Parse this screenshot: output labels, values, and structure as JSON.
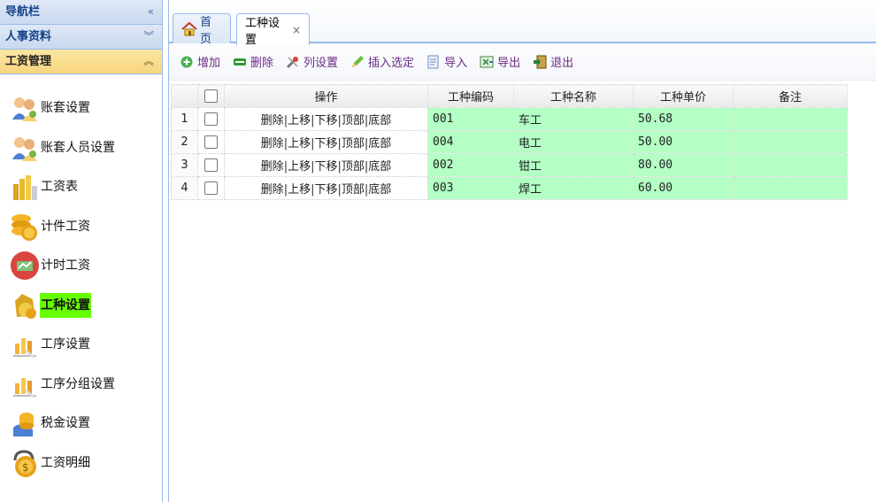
{
  "sidebar": {
    "nav_header": "导航栏",
    "hr_header": "人事资料",
    "salary_header": "工资管理",
    "items": [
      {
        "label": "账套设置",
        "icon": "people-icon"
      },
      {
        "label": "账套人员设置",
        "icon": "people-icon"
      },
      {
        "label": "工资表",
        "icon": "money-stack-icon"
      },
      {
        "label": "计件工资",
        "icon": "coins-icon"
      },
      {
        "label": "计时工资",
        "icon": "clock-money-icon"
      },
      {
        "label": "工种设置",
        "icon": "money-bag-icon",
        "selected": true
      },
      {
        "label": "工序设置",
        "icon": "chart-icon"
      },
      {
        "label": "工序分组设置",
        "icon": "chart-icon"
      },
      {
        "label": "税金设置",
        "icon": "tax-icon"
      },
      {
        "label": "工资明细",
        "icon": "moneybag-lock-icon"
      }
    ]
  },
  "tabs": {
    "home": "首页",
    "worktype": "工种设置",
    "close": "×"
  },
  "toolbar": {
    "add": "增加",
    "delete": "删除",
    "columns": "列设置",
    "insert": "插入选定",
    "import": "导入",
    "export": "导出",
    "exit": "退出"
  },
  "grid": {
    "headers": {
      "ops": "操作",
      "code": "工种编码",
      "name": "工种名称",
      "price": "工种单价",
      "note": "备注"
    },
    "op_labels": [
      "删除",
      "上移",
      "下移",
      "顶部",
      "底部"
    ],
    "rows": [
      {
        "n": "1",
        "code": "001",
        "name": "车工",
        "price": "50.68",
        "note": ""
      },
      {
        "n": "2",
        "code": "004",
        "name": "电工",
        "price": "50.00",
        "note": ""
      },
      {
        "n": "3",
        "code": "002",
        "name": "钳工",
        "price": "80.00",
        "note": ""
      },
      {
        "n": "4",
        "code": "003",
        "name": "焊工",
        "price": "60.00",
        "note": ""
      }
    ]
  },
  "colors": {
    "accent": "#99bbe8",
    "selected_nav": "#66ff00",
    "editable_cell": "#b3ffc4",
    "toolbar_text": "#6b2b86"
  }
}
